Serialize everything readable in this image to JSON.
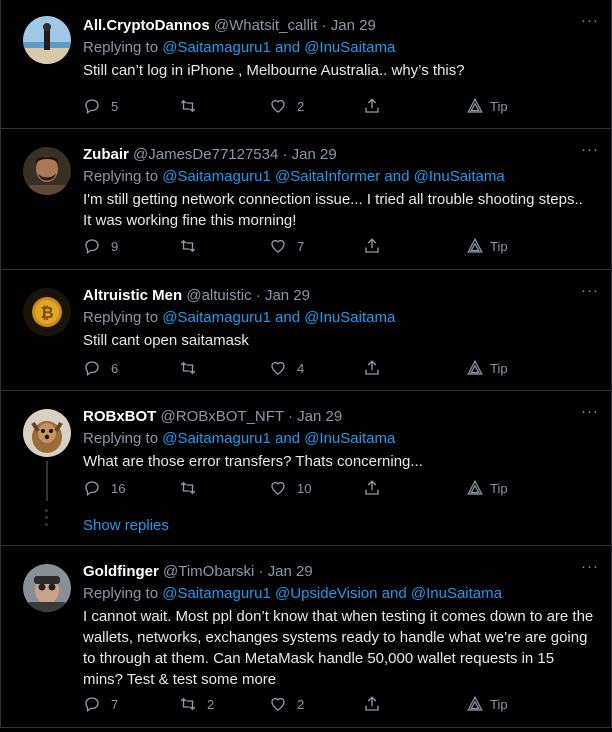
{
  "tweets": [
    {
      "name": "All.CryptoDannos",
      "handle": "@Whatsit_callit",
      "date": "· Jan 29",
      "replying_prefix": "Replying to ",
      "replying_links": "@Saitamaguru1 and @InuSaitama",
      "text": "Still can’t log in iPhone , Melbourne Australia.. why’s this?",
      "replies": "5",
      "retweets": "",
      "likes": "2",
      "tip": "Tip"
    },
    {
      "name": "Zubair",
      "handle": "@JamesDe77127534",
      "date": "· Jan 29",
      "replying_prefix": "Replying to ",
      "replying_links": "@Saitamaguru1 @SaitaInformer and @InuSaitama",
      "text": "I'm still getting network connection issue... I tried all trouble shooting steps.. It was working fine this morning!",
      "replies": "9",
      "retweets": "",
      "likes": "7",
      "tip": "Tip"
    },
    {
      "name": "Altruistic Men",
      "handle": "@altuistic",
      "date": "· Jan 29",
      "replying_prefix": "Replying to ",
      "replying_links": "@Saitamaguru1 and @InuSaitama",
      "text": "Still cant open saitamask",
      "replies": "6",
      "retweets": "",
      "likes": "4",
      "tip": "Tip"
    },
    {
      "name": "ROBxBOT",
      "handle": "@ROBxBOT_NFT",
      "date": "· Jan 29",
      "replying_prefix": "Replying to ",
      "replying_links": "@Saitamaguru1 and @InuSaitama",
      "text": "What are those error transfers?  Thats concerning...",
      "replies": "16",
      "retweets": "",
      "likes": "10",
      "tip": "Tip"
    },
    {
      "name": "Goldfinger",
      "handle": "@TimObarski",
      "date": "· Jan 29",
      "replying_prefix": "Replying to ",
      "replying_links": "@Saitamaguru1 @UpsideVision and @InuSaitama",
      "text": "I cannot wait. Most ppl don’t know that when testing it comes down to are the wallets, networks, exchanges systems ready to handle what we’re are going to through at them. Can MetaMask handle 50,000 wallet requests in 15 mins? Test & test some more",
      "replies": "7",
      "retweets": "2",
      "likes": "2",
      "tip": "Tip"
    }
  ],
  "show_replies": "Show replies",
  "more_glyph": "···",
  "colors": {
    "accent": "#1d9bf0",
    "muted": "#8b98a5",
    "border": "#2f3336"
  }
}
